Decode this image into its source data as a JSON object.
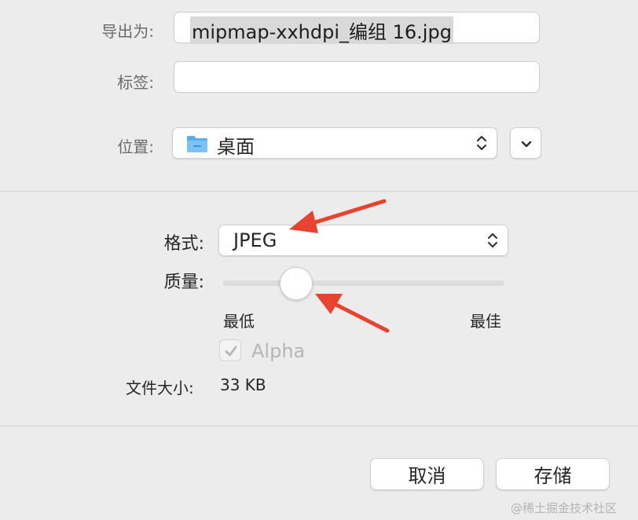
{
  "export": {
    "export_as_label": "导出为:",
    "filename_value": "mipmap-xxhdpi_编组 16.jpg",
    "tags_label": "标签:",
    "tags_value": "",
    "location_label": "位置:",
    "location_value": "桌面",
    "location_icon": "folder-icon"
  },
  "options": {
    "format_label": "格式:",
    "format_value": "JPEG",
    "quality_label": "质量:",
    "quality_level": 0.26,
    "quality_min_label": "最低",
    "quality_max_label": "最佳",
    "alpha_label": "Alpha",
    "alpha_checked": true,
    "alpha_enabled": false,
    "file_size_label": "文件大小:",
    "file_size_value": "33 KB"
  },
  "buttons": {
    "cancel_label": "取消",
    "save_label": "存储"
  },
  "watermark": "@稀土掘金技术社区",
  "colors": {
    "annotation_arrow": "#e8432f",
    "folder": "#5aaef0",
    "background": "#ececec"
  }
}
